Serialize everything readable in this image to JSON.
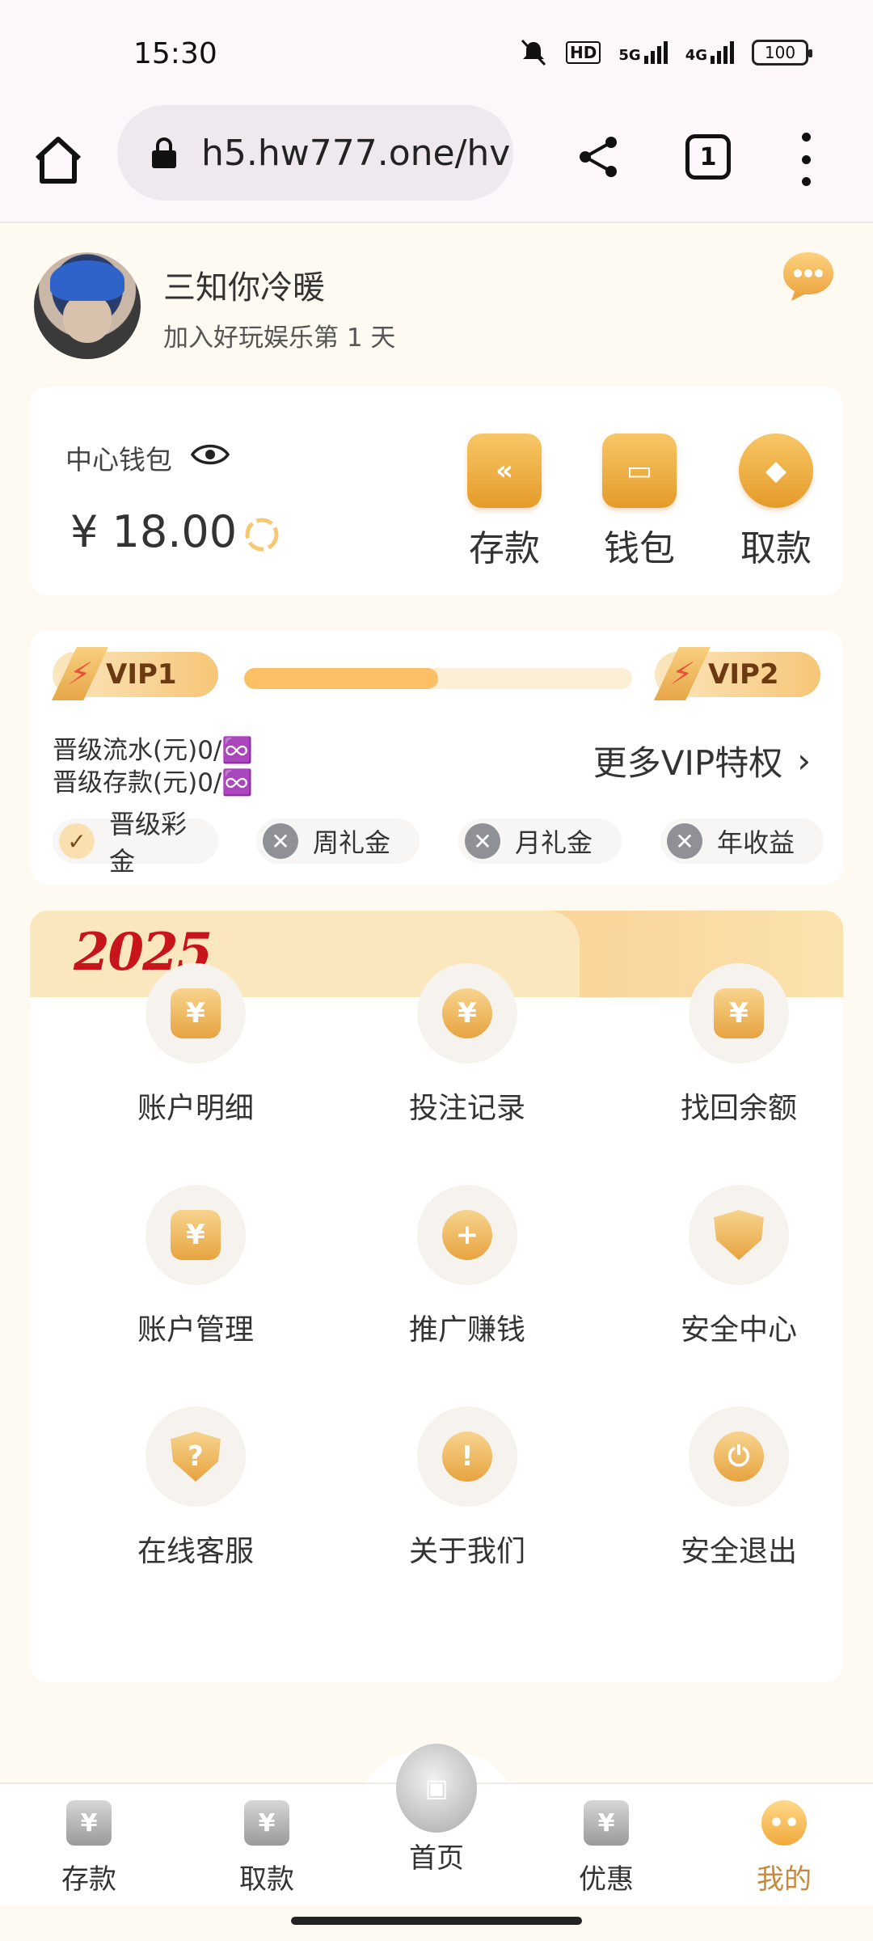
{
  "status_bar": {
    "time": "15:30",
    "network_hd": "HD",
    "network_5g": "5G",
    "network_4g": "4G",
    "battery": "100"
  },
  "browser": {
    "url": "h5.hw777.one/hv",
    "tab_count": "1"
  },
  "profile": {
    "name": "三知你冷暖",
    "joined": "加入好玩娱乐第 1 天"
  },
  "wallet": {
    "label": "中心钱包",
    "balance": "¥ 18.00",
    "actions": [
      {
        "label": "存款",
        "icon": "deposit-icon"
      },
      {
        "label": "钱包",
        "icon": "wallet-icon"
      },
      {
        "label": "取款",
        "icon": "withdraw-icon"
      }
    ]
  },
  "vip": {
    "current": "VIP1",
    "next": "VIP2",
    "progress_percent": 50,
    "line1": "晋级流水(元)0/♾️",
    "line2": "晋级存款(元)0/♾️",
    "more": "更多VIP特权",
    "perks": [
      {
        "label": "晋级彩金",
        "enabled": true
      },
      {
        "label": "周礼金",
        "enabled": false
      },
      {
        "label": "月礼金",
        "enabled": false
      },
      {
        "label": "年收益",
        "enabled": false
      }
    ]
  },
  "banner": {
    "year": "2025"
  },
  "menu": [
    {
      "label": "账户明细",
      "icon": "account-details-icon",
      "glyph": "¥"
    },
    {
      "label": "投注记录",
      "icon": "bet-record-icon",
      "glyph": "¥"
    },
    {
      "label": "找回余额",
      "icon": "recover-balance-icon",
      "glyph": "¥"
    },
    {
      "label": "账户管理",
      "icon": "account-manage-icon",
      "glyph": "¥"
    },
    {
      "label": "推广赚钱",
      "icon": "promote-icon",
      "glyph": "+"
    },
    {
      "label": "安全中心",
      "icon": "security-shield-icon",
      "glyph": ""
    },
    {
      "label": "在线客服",
      "icon": "support-icon",
      "glyph": "?"
    },
    {
      "label": "关于我们",
      "icon": "about-icon",
      "glyph": "!"
    },
    {
      "label": "安全退出",
      "icon": "power-icon",
      "glyph": "⏻"
    }
  ],
  "nav": [
    {
      "label": "存款",
      "glyph": "¥"
    },
    {
      "label": "取款",
      "glyph": "¥"
    },
    {
      "label": "首页",
      "glyph": "▣"
    },
    {
      "label": "优惠",
      "glyph": "¥"
    },
    {
      "label": "我的",
      "glyph": "••"
    }
  ],
  "colors": {
    "accent": "#f1a93c",
    "page_bg": "#fffaf1",
    "active_nav": "#c9893d",
    "banner_red": "#c8151c"
  }
}
